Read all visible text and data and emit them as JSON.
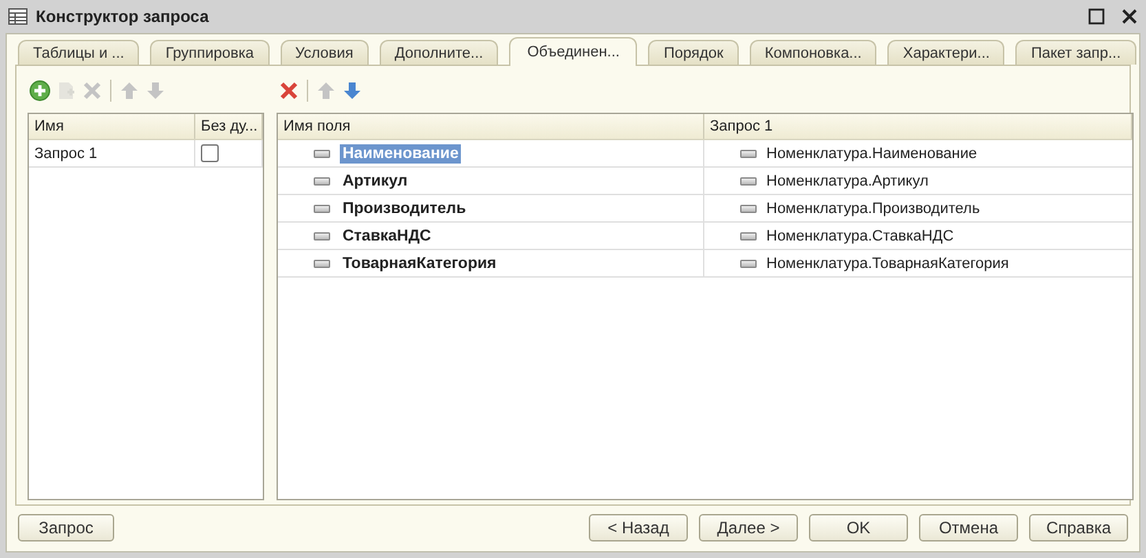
{
  "window": {
    "title": "Конструктор запроса"
  },
  "tabs": [
    {
      "label": "Таблицы и ...",
      "selected": false
    },
    {
      "label": "Группировка",
      "selected": false
    },
    {
      "label": "Условия",
      "selected": false
    },
    {
      "label": "Дополните...",
      "selected": false
    },
    {
      "label": "Объединен...",
      "selected": true
    },
    {
      "label": "Порядок",
      "selected": false
    },
    {
      "label": "Компоновка...",
      "selected": false
    },
    {
      "label": "Характери...",
      "selected": false
    },
    {
      "label": "Пакет запр...",
      "selected": false
    }
  ],
  "left_toolbar": [
    {
      "kind": "add",
      "disabled": false
    },
    {
      "kind": "copy",
      "disabled": true
    },
    {
      "kind": "delete",
      "disabled": true
    },
    {
      "kind": "up",
      "disabled": true
    },
    {
      "kind": "down",
      "disabled": true
    }
  ],
  "right_toolbar": [
    {
      "kind": "delete",
      "disabled": false
    },
    {
      "kind": "up",
      "disabled": true
    },
    {
      "kind": "down",
      "disabled": false
    }
  ],
  "queries_table": {
    "columns": [
      "Имя",
      "Без ду..."
    ],
    "rows": [
      {
        "name": "Запрос 1",
        "checked": false
      }
    ]
  },
  "fields_table": {
    "columns": [
      "Имя поля",
      "Запрос 1"
    ],
    "rows": [
      {
        "field": "Наименование",
        "source": "Номенклатура.Наименование",
        "selected": true
      },
      {
        "field": "Артикул",
        "source": "Номенклатура.Артикул",
        "selected": false
      },
      {
        "field": "Производитель",
        "source": "Номенклатура.Производитель",
        "selected": false
      },
      {
        "field": "СтавкаНДС",
        "source": "Номенклатура.СтавкаНДС",
        "selected": false
      },
      {
        "field": "ТоварнаяКатегория",
        "source": "Номенклатура.ТоварнаяКатегория",
        "selected": false
      }
    ]
  },
  "left_buttons": [
    {
      "label": "Запрос"
    }
  ],
  "right_buttons": [
    {
      "label": "< Назад"
    },
    {
      "label": "Далее >"
    },
    {
      "label": "OK"
    },
    {
      "label": "Отмена"
    },
    {
      "label": "Справка"
    }
  ]
}
